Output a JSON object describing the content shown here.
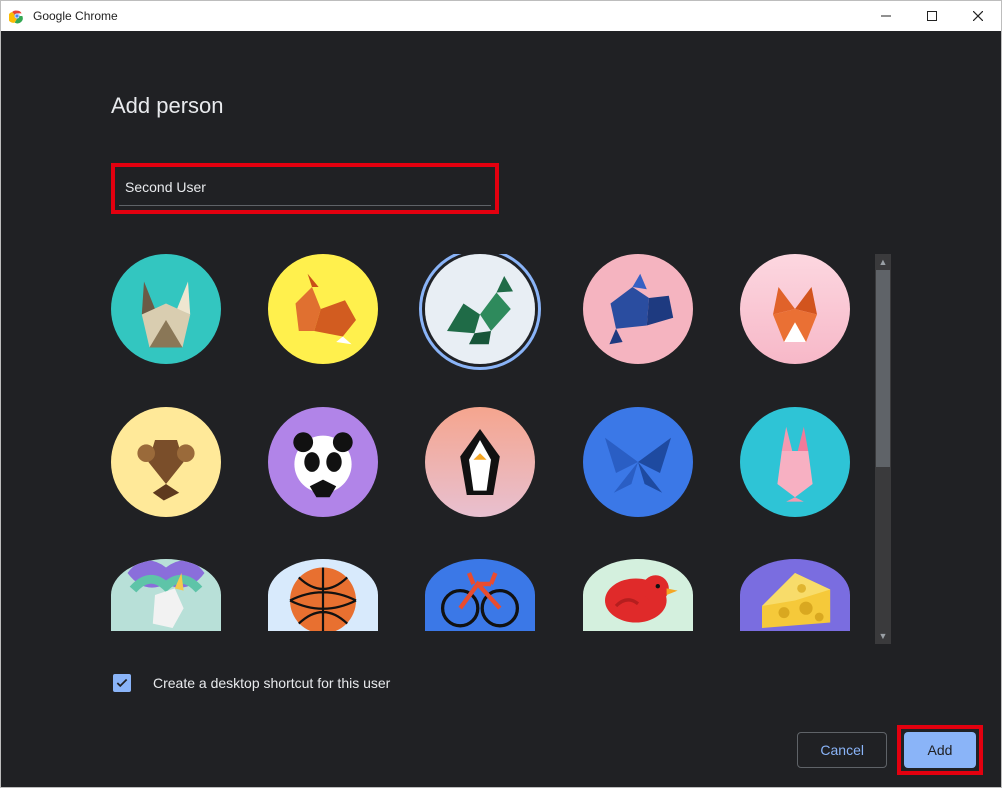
{
  "window": {
    "title": "Google Chrome"
  },
  "dialog": {
    "heading": "Add person",
    "name_value": "Second User",
    "shortcut_label": "Create a desktop shortcut for this user",
    "shortcut_checked": true,
    "cancel_label": "Cancel",
    "add_label": "Add",
    "selected_avatar_index": 2,
    "avatars": [
      {
        "id": "origami-cat",
        "bg": "#33c6c0"
      },
      {
        "id": "origami-corgi",
        "bg": "#fff04d"
      },
      {
        "id": "origami-dragon",
        "bg": "#e8eef4"
      },
      {
        "id": "origami-elephant",
        "bg": "#f5b4c0"
      },
      {
        "id": "origami-fox",
        "bg": "#fcd7e0"
      },
      {
        "id": "origami-monkey",
        "bg": "#ffe999"
      },
      {
        "id": "origami-panda",
        "bg": "#b184e8"
      },
      {
        "id": "origami-penguin",
        "bg": "#f59c87"
      },
      {
        "id": "origami-butterfly",
        "bg": "#3b78e7"
      },
      {
        "id": "origami-rabbit",
        "bg": "#2ec4d6"
      },
      {
        "id": "origami-unicorn",
        "bg": "#b8e0d8"
      },
      {
        "id": "basketball",
        "bg": "#d8eafc"
      },
      {
        "id": "bicycle",
        "bg": "#3b78e7"
      },
      {
        "id": "bird",
        "bg": "#d4f0de"
      },
      {
        "id": "cheese",
        "bg": "#7a6de0"
      }
    ]
  },
  "highlights": {
    "name_input": true,
    "add_button": true
  }
}
